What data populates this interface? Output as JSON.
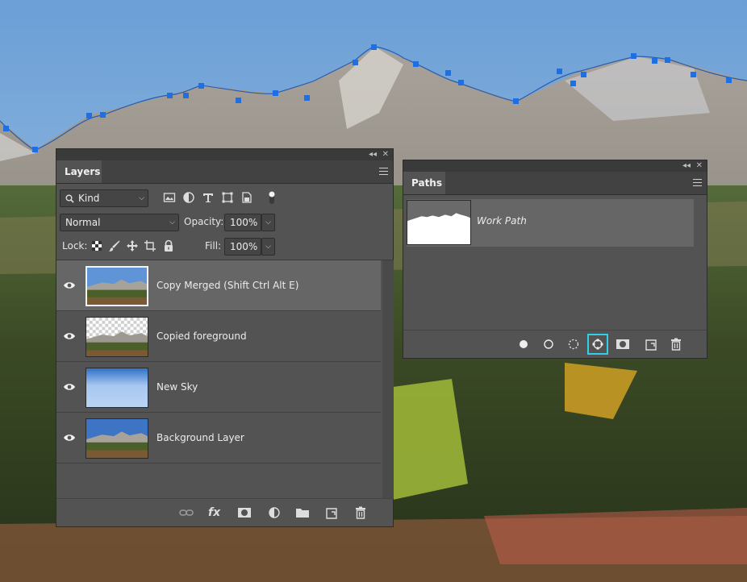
{
  "layers_panel": {
    "tab_label": "Layers",
    "filter": {
      "value": "Kind"
    },
    "blend_mode": "Normal",
    "opacity_label": "Opacity:",
    "opacity_value": "100%",
    "lock_label": "Lock:",
    "fill_label": "Fill:",
    "fill_value": "100%",
    "layers": [
      {
        "name": "Copy Merged (Shift Ctrl Alt E)",
        "selected": true
      },
      {
        "name": "Copied foreground",
        "selected": false
      },
      {
        "name": "New Sky",
        "selected": false
      },
      {
        "name": "Background Layer",
        "selected": false
      }
    ]
  },
  "paths_panel": {
    "tab_label": "Paths",
    "paths": [
      {
        "name": "Work Path",
        "selected": true
      }
    ]
  },
  "colors": {
    "panel_bg": "#535353",
    "selected_row": "#666666",
    "highlight": "#2fd0e8",
    "path_anchor": "#1f6fe0"
  },
  "icons": [
    "eye-icon",
    "search-icon",
    "image-filter-icon",
    "adjustment-filter-icon",
    "type-filter-icon",
    "shape-filter-icon",
    "smart-object-filter-icon",
    "filter-toggle-icon",
    "lock-transparent-icon",
    "lock-brush-icon",
    "lock-move-icon",
    "lock-artboard-icon",
    "lock-all-icon",
    "link-icon",
    "fx-icon",
    "mask-icon",
    "adjustment-icon",
    "folder-icon",
    "new-layer-icon",
    "trash-icon",
    "fill-path-icon",
    "stroke-path-icon",
    "load-selection-icon",
    "make-work-path-icon",
    "add-mask-icon",
    "new-path-icon"
  ]
}
